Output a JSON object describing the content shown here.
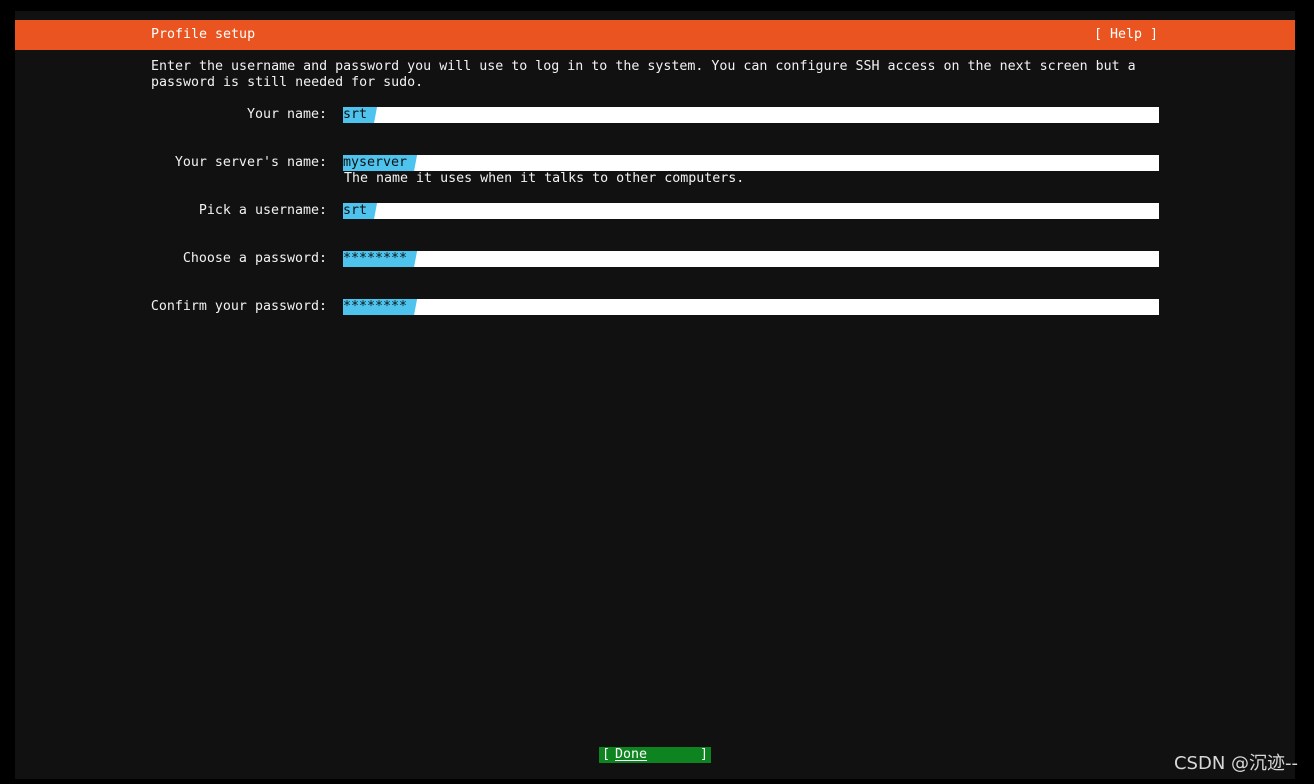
{
  "header": {
    "title": "Profile setup",
    "help_label": "[ Help ]"
  },
  "intro_text": "Enter the username and password you will use to log in to the system. You can configure SSH access on the next screen but a password is still needed for sudo.",
  "fields": {
    "your_name": {
      "label": "Your name:",
      "value": "srt"
    },
    "server_name": {
      "label": "Your server's name:",
      "value": "myserver",
      "hint": "The name it uses when it talks to other computers."
    },
    "username": {
      "label": "Pick a username:",
      "value": "srt"
    },
    "password": {
      "label": "Choose a password:",
      "value": "********"
    },
    "confirm_password": {
      "label": "Confirm your password:",
      "value": "********"
    }
  },
  "done_button": {
    "open_bracket": "[",
    "label": "Done",
    "close_bracket": "]"
  },
  "watermark": "CSDN @沉迹--",
  "colors": {
    "header": "#e95420",
    "field_highlight": "#4dc3ee",
    "button": "#0e8420",
    "background": "#111111"
  }
}
